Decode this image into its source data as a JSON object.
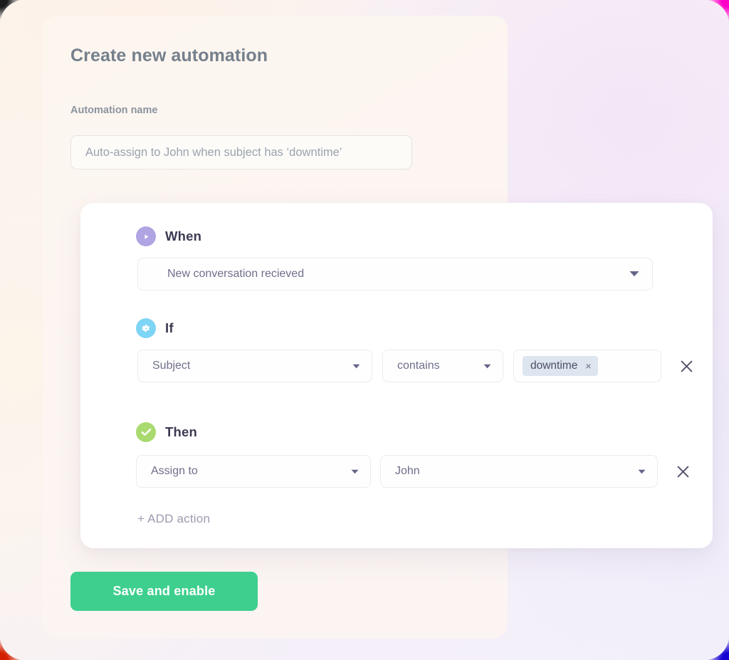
{
  "panel": {
    "title": "Create new automation",
    "name_field": {
      "label": "Automation name",
      "value": "",
      "placeholder": "Auto-assign to John when subject has ‘downtime’"
    }
  },
  "builder": {
    "when": {
      "icon": "play-circle-icon",
      "icon_color": "#b0a4e3",
      "title": "When",
      "trigger": {
        "value": "New conversation recieved",
        "caret": "chevron-down-icon"
      }
    },
    "if": {
      "icon": "gear-circle-icon",
      "icon_color": "#7ed4f4",
      "title": "If",
      "condition": {
        "field": "Subject",
        "operator": "contains",
        "value_chip": "downtime",
        "chip_remove": "×",
        "remove_label": "×"
      }
    },
    "then": {
      "icon": "check-circle-icon",
      "icon_color": "#a9da6f",
      "title": "Then",
      "action": {
        "type": "Assign to",
        "target": "John",
        "remove_label": "×"
      }
    },
    "add_action_label": "+ ADD action"
  },
  "footer": {
    "save_label": "Save and enable",
    "save_color": "#3ecf8e"
  }
}
